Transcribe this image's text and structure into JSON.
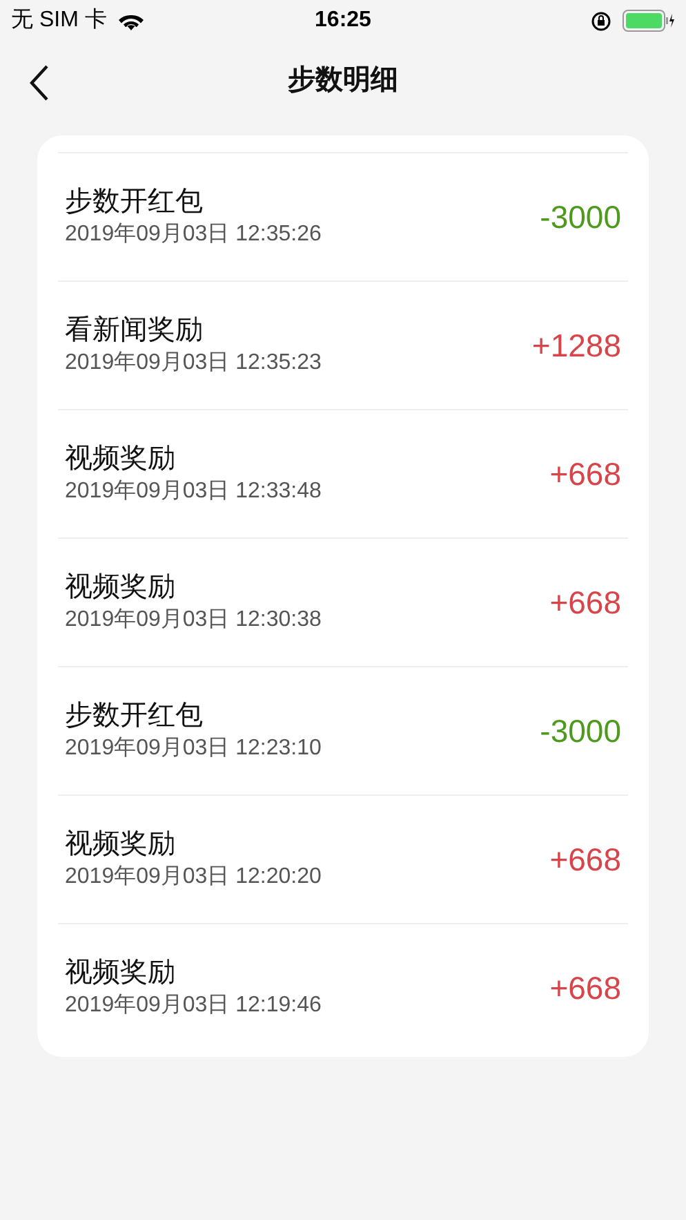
{
  "status_bar": {
    "carrier": "无 SIM 卡",
    "time": "16:25"
  },
  "nav": {
    "title": "步数明细"
  },
  "records": [
    {
      "title": "步数开红包",
      "time": "2019年09月03日 12:35:26",
      "amount": "-3000",
      "kind": "debit"
    },
    {
      "title": "看新闻奖励",
      "time": "2019年09月03日 12:35:23",
      "amount": "+1288",
      "kind": "credit"
    },
    {
      "title": "视频奖励",
      "time": "2019年09月03日 12:33:48",
      "amount": "+668",
      "kind": "credit"
    },
    {
      "title": "视频奖励",
      "time": "2019年09月03日 12:30:38",
      "amount": "+668",
      "kind": "credit"
    },
    {
      "title": "步数开红包",
      "time": "2019年09月03日 12:23:10",
      "amount": "-3000",
      "kind": "debit"
    },
    {
      "title": "视频奖励",
      "time": "2019年09月03日 12:20:20",
      "amount": "+668",
      "kind": "credit"
    },
    {
      "title": "视频奖励",
      "time": "2019年09月03日 12:19:46",
      "amount": "+668",
      "kind": "credit"
    }
  ]
}
